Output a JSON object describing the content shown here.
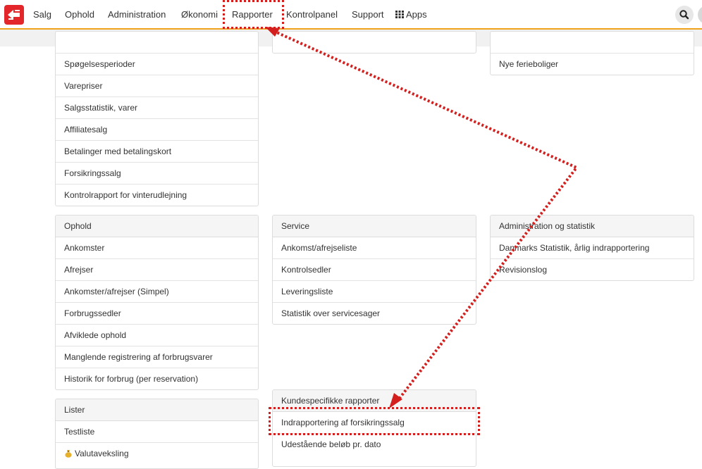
{
  "nav": {
    "items": [
      "Salg",
      "Ophold",
      "Administration",
      "Økonomi",
      "Rapporter",
      "Kontrolpanel",
      "Support",
      "Apps"
    ],
    "highlighted": "Rapporter"
  },
  "colors": {
    "accent": "#f0a21a",
    "logo": "#e2262a",
    "annotation": "#d3201e"
  },
  "icons": {
    "logo": "logo-icon",
    "apps": "grid-icon",
    "search": "search-icon",
    "valuta": "money-bag-icon"
  },
  "panels": {
    "top_left": {
      "rows": [
        "Spøgelsesperioder",
        "Varepriser",
        "Salgsstatistik, varer",
        "Affiliatesalg",
        "Betalinger med betalingskort",
        "Forsikringssalg",
        "Kontrolrapport for vinterudlejning"
      ]
    },
    "top_right": {
      "rows": [
        "Nye ferieboliger"
      ]
    },
    "ophold": {
      "title": "Ophold",
      "rows": [
        "Ankomster",
        "Afrejser",
        "Ankomster/afrejser (Simpel)",
        "Forbrugssedler",
        "Afviklede ophold",
        "Manglende registrering af forbrugsvarer",
        "Historik for forbrug (per reservation)"
      ]
    },
    "service": {
      "title": "Service",
      "rows": [
        "Ankomst/afrejseliste",
        "Kontrolsedler",
        "Leveringsliste",
        "Statistik over servicesager"
      ]
    },
    "admin_stat": {
      "title": "Administration og statistik",
      "rows": [
        "Danmarks Statistik, årlig indrapportering",
        "Revisionslog"
      ]
    },
    "lister": {
      "title": "Lister",
      "rows": [
        "Testliste",
        "Valutaveksling"
      ]
    },
    "kunde": {
      "title": "Kundespecifikke rapporter",
      "rows": [
        "Indrapportering af forsikringssalg",
        "Udestående beløb pr. dato"
      ],
      "highlighted": "Indrapportering af forsikringssalg"
    }
  }
}
